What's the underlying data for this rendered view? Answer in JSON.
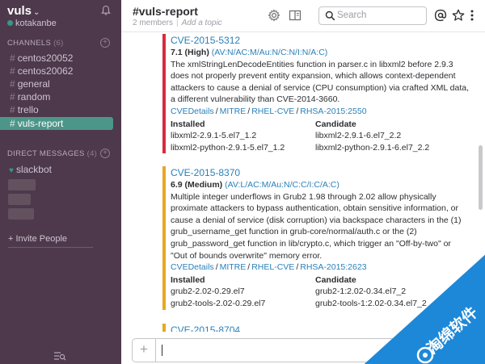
{
  "sidebar": {
    "team_name": "vuls",
    "team_chevron": "⌄",
    "username": "kotakanbe",
    "channels_label": "CHANNELS",
    "channels_count": "(6)",
    "channels": [
      "centos20052",
      "centos20062",
      "general",
      "random",
      "trello",
      "vuls-report"
    ],
    "active_channel_index": 5,
    "dm_label": "DIRECT MESSAGES",
    "dm_count": "(4)",
    "dm_items": [
      "slackbot"
    ],
    "invite_label": "Invite People"
  },
  "header": {
    "channel_title": "#vuls-report",
    "members": "2 members",
    "topic_placeholder": "Add a topic",
    "search_placeholder": "Search"
  },
  "messages": [
    {
      "severity": "high",
      "cve_id": "CVE-2015-5312",
      "score": "7.1 (High)",
      "vector": "(AV:N/AC:M/Au:N/C:N/I:N/A:C)",
      "description": "The xmlStringLenDecodeEntities function in parser.c in libxml2 before 2.9.3 does not properly prevent entity expansion, which allows context-dependent attackers to cause a denial of service (CPU consumption) via crafted XML data, a different vulnerability than CVE-2014-3660.",
      "links": [
        "CVEDetails",
        "MITRE",
        "RHEL-CVE",
        "RHSA-2015:2550"
      ],
      "installed_header": "Installed",
      "candidate_header": "Candidate",
      "installed": [
        "libxml2-2.9.1-5.el7_1.2",
        "libxml2-python-2.9.1-5.el7_1.2"
      ],
      "candidate": [
        "libxml2-2.9.1-6.el7_2.2",
        "libxml2-python-2.9.1-6.el7_2.2"
      ]
    },
    {
      "severity": "medium",
      "cve_id": "CVE-2015-8370",
      "score": "6.9 (Medium)",
      "vector": "(AV:L/AC:M/Au:N/C:C/I:C/A:C)",
      "description": "Multiple integer underflows in Grub2 1.98 through 2.02 allow physically proximate attackers to bypass authentication, obtain sensitive information, or cause a denial of service (disk corruption) via backspace characters in the (1) grub_username_get function in grub-core/normal/auth.c or the (2) grub_password_get function in lib/crypto.c, which trigger an \"Off-by-two\" or \"Out of bounds overwrite\" memory error.",
      "links": [
        "CVEDetails",
        "MITRE",
        "RHEL-CVE",
        "RHSA-2015:2623"
      ],
      "installed_header": "Installed",
      "candidate_header": "Candidate",
      "installed": [
        "grub2-2.02-0.29.el7",
        "grub2-tools-2.02-0.29.el7"
      ],
      "candidate": [
        "grub2-1:2.02-0.34.el7_2",
        "grub2-tools-1:2.02-0.34.el7_2"
      ]
    },
    {
      "severity": "medium",
      "cve_id": "CVE-2015-8704"
    }
  ],
  "watermark_text": "淘绵软件",
  "colors": {
    "sidebar_bg": "#4d394b",
    "active_channel": "#4c9689",
    "link": "#2a80b9",
    "high": "#d72b3f",
    "medium": "#e8a723",
    "watermark": "#1e88d8"
  }
}
